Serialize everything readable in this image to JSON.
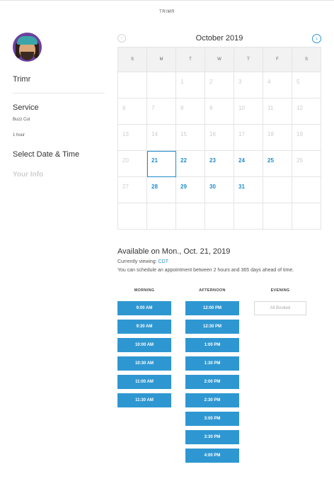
{
  "header": {
    "brand": "TRIMR"
  },
  "sidebar": {
    "business_name": "Trimr",
    "service_heading": "Service",
    "service_name": "Buzz Cut",
    "service_duration": "1 hour",
    "step_date_time": "Select Date & Time",
    "step_your_info": "Your Info"
  },
  "calendar": {
    "title": "October 2019",
    "prev_icon": "chevron-left-icon",
    "next_icon": "chevron-right-icon",
    "weekdays": [
      "S",
      "M",
      "T",
      "W",
      "T",
      "F",
      "S"
    ],
    "weeks": [
      [
        {
          "day": "",
          "state": "empty"
        },
        {
          "day": "",
          "state": "empty"
        },
        {
          "day": "1",
          "state": "past"
        },
        {
          "day": "2",
          "state": "past"
        },
        {
          "day": "3",
          "state": "past"
        },
        {
          "day": "4",
          "state": "past"
        },
        {
          "day": "5",
          "state": "past"
        }
      ],
      [
        {
          "day": "6",
          "state": "past"
        },
        {
          "day": "7",
          "state": "past"
        },
        {
          "day": "8",
          "state": "past"
        },
        {
          "day": "9",
          "state": "past"
        },
        {
          "day": "10",
          "state": "past"
        },
        {
          "day": "11",
          "state": "past"
        },
        {
          "day": "12",
          "state": "past"
        }
      ],
      [
        {
          "day": "13",
          "state": "past"
        },
        {
          "day": "14",
          "state": "past"
        },
        {
          "day": "15",
          "state": "past"
        },
        {
          "day": "16",
          "state": "past"
        },
        {
          "day": "17",
          "state": "past"
        },
        {
          "day": "18",
          "state": "past"
        },
        {
          "day": "19",
          "state": "past"
        }
      ],
      [
        {
          "day": "20",
          "state": "past"
        },
        {
          "day": "21",
          "state": "selected"
        },
        {
          "day": "22",
          "state": "avail"
        },
        {
          "day": "23",
          "state": "avail"
        },
        {
          "day": "24",
          "state": "avail"
        },
        {
          "day": "25",
          "state": "avail"
        },
        {
          "day": "26",
          "state": "past"
        }
      ],
      [
        {
          "day": "27",
          "state": "past"
        },
        {
          "day": "28",
          "state": "avail"
        },
        {
          "day": "29",
          "state": "avail"
        },
        {
          "day": "30",
          "state": "avail"
        },
        {
          "day": "31",
          "state": "avail"
        },
        {
          "day": "",
          "state": "empty"
        },
        {
          "day": "",
          "state": "empty"
        }
      ],
      [
        {
          "day": "",
          "state": "empty"
        },
        {
          "day": "",
          "state": "empty"
        },
        {
          "day": "",
          "state": "empty"
        },
        {
          "day": "",
          "state": "empty"
        },
        {
          "day": "",
          "state": "empty"
        },
        {
          "day": "",
          "state": "empty"
        },
        {
          "day": "",
          "state": "empty"
        }
      ]
    ]
  },
  "availability": {
    "title": "Available on Mon., Oct. 21, 2019",
    "viewing_label": "Currently viewing:",
    "timezone": "CDT",
    "note": "You can schedule an appointment between 2 hours and 365 days ahead of time.",
    "morning_label": "MORNING",
    "afternoon_label": "AFTERNOON",
    "evening_label": "EVENING",
    "morning": [
      "9:00 AM",
      "9:30 AM",
      "10:00 AM",
      "10:30 AM",
      "11:00 AM",
      "11:30 AM"
    ],
    "afternoon": [
      "12:00 PM",
      "12:30 PM",
      "1:00 PM",
      "1:30 PM",
      "2:00 PM",
      "2:30 PM",
      "3:00 PM",
      "3:30 PM",
      "4:00 PM"
    ],
    "evening_status": "All Booked"
  },
  "colors": {
    "accent": "#2e97d1",
    "muted": "#cccccc"
  }
}
